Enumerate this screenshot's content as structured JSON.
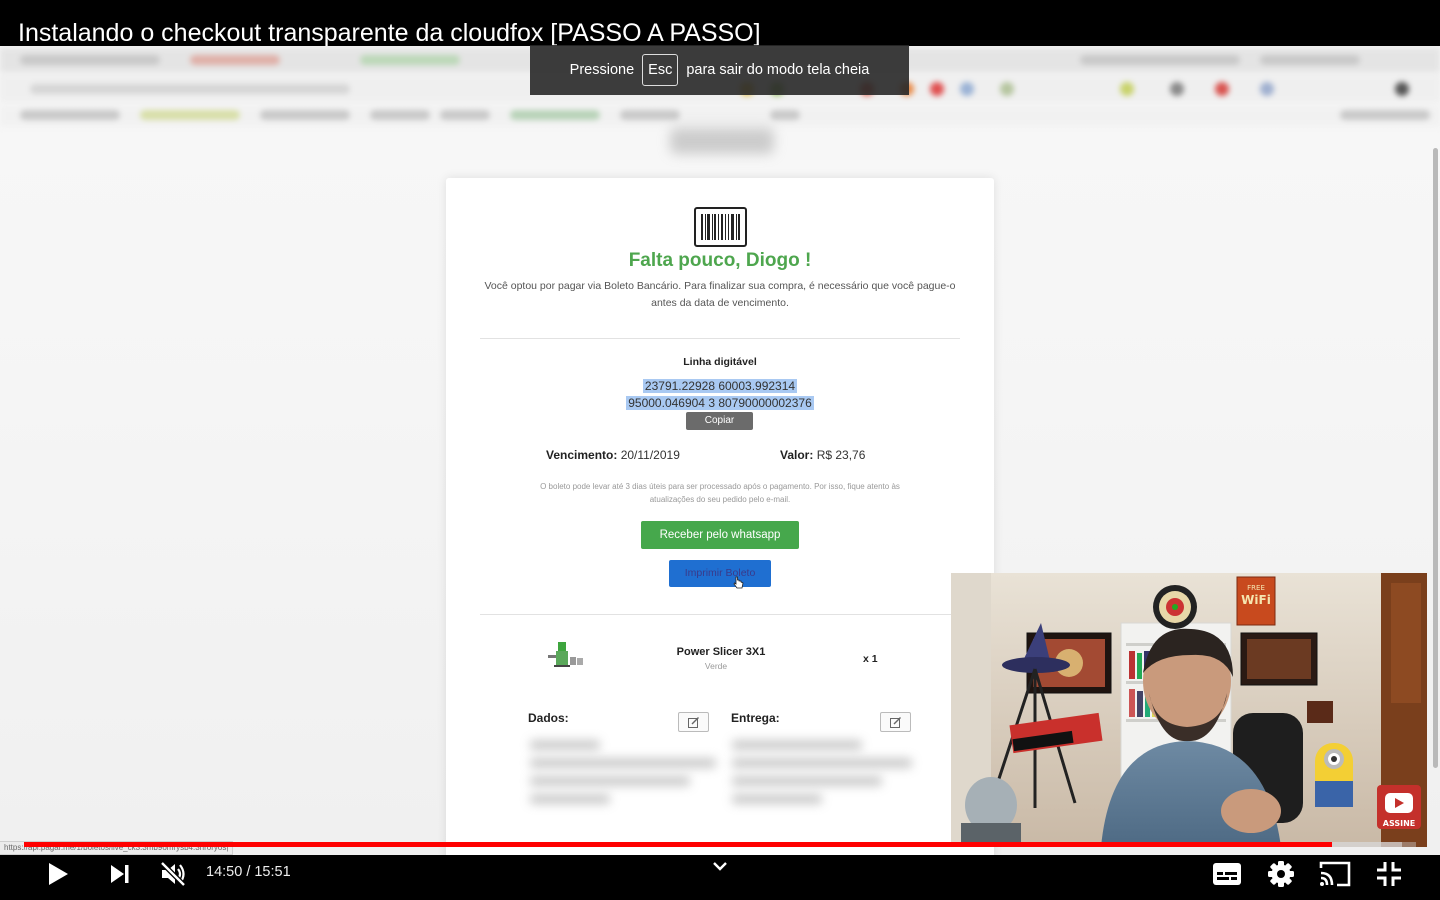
{
  "player": {
    "title": "Instalando o checkout transparente da cloudfox [PASSO A PASSO]",
    "fullscreen_hint": {
      "prefix": "Pressione",
      "key": "Esc",
      "suffix": "para sair do modo tela cheia"
    },
    "time": "14:50 / 15:51",
    "progress": {
      "played_fraction": 0.94,
      "buffered_fraction": 0.99
    },
    "icons": {
      "play": "play-icon",
      "next": "next-icon",
      "mute": "muted-volume-icon",
      "chevron": "chevron-down-icon",
      "subtitles": "subtitles-icon",
      "settings": "gear-icon",
      "cast": "cast-icon",
      "exit_fullscreen": "exit-fullscreen-icon"
    },
    "colors": {
      "accent": "#ff0000",
      "bar": "#000000"
    }
  },
  "page": {
    "status_url": "https://api.pagar.me/1/boletos/live_ck3.3mb9omrysb4.3nroryos|",
    "greeting": "Falta pouco, Diogo !",
    "intro": "Você optou por pagar via Boleto Bancário. Para finalizar sua compra, é necessário que você pague-o antes da data de vencimento.",
    "line_title": "Linha digitável",
    "line_1": "23791.22928 60003.992314",
    "line_2": "95000.046904 3 80790000002376",
    "copy_label": "Copiar",
    "due_label": "Vencimento:",
    "due_value": "20/11/2019",
    "value_label": "Valor:",
    "value_value": "R$ 23,76",
    "notice": "O boleto pode levar até 3 dias úteis para ser processado após o pagamento. Por isso, fique atento às atualizações do seu pedido pelo e-mail.",
    "whatsapp_button": "Receber pelo whatsapp",
    "print_button": "Imprimir Boleto",
    "product_name": "Power Slicer 3X1",
    "product_variant": "Verde",
    "product_qty": "x 1",
    "data_label": "Dados:",
    "delivery_label": "Entrega:",
    "colors": {
      "green": "#46a84c",
      "blue": "#1f6fd1",
      "highlight": "#a9c9f2"
    }
  },
  "webcam": {
    "wifi_sign": "FREE WiFi",
    "subscribe_label": "ASSINE"
  }
}
